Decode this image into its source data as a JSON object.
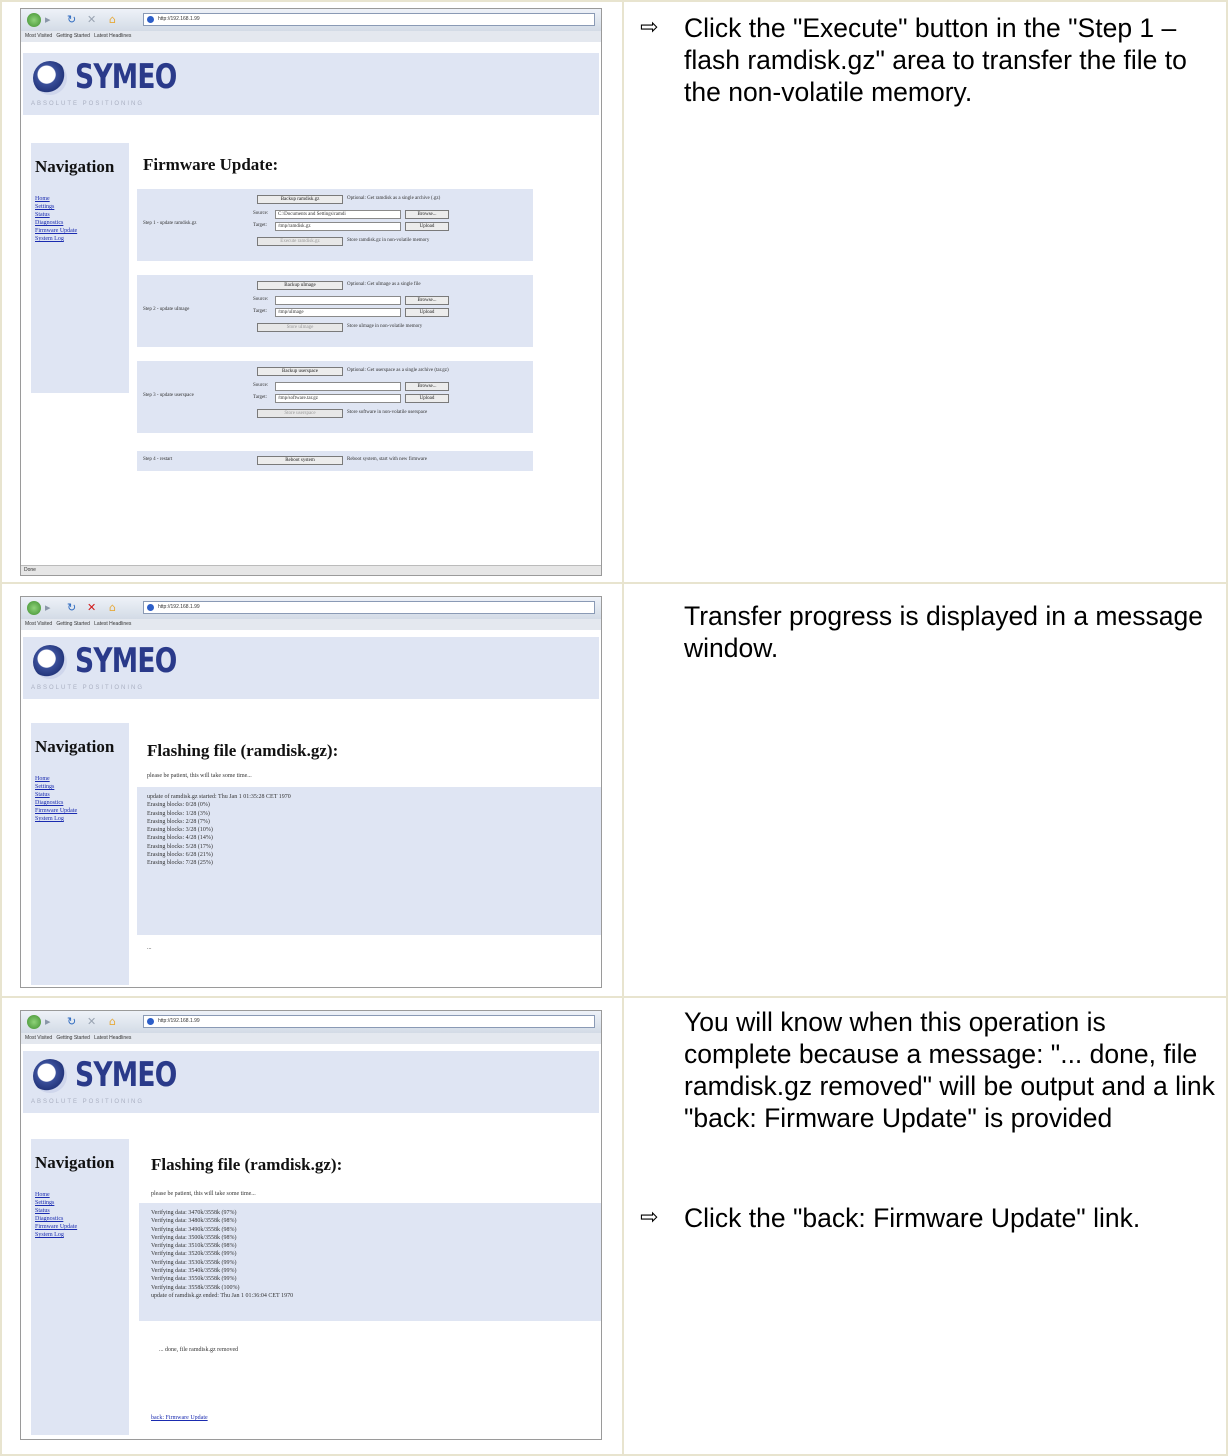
{
  "browser": {
    "url": "http://192.168.1.99",
    "bookmarks": [
      "Most Visited",
      "Getting Started",
      "Latest Headlines"
    ],
    "status": "Done"
  },
  "site": {
    "logo_text": "SYMEO",
    "logo_subtitle": "ABSOLUTE POSITIONING",
    "nav_heading": "Navigation",
    "nav_links": [
      "Home",
      "Settings",
      "Status",
      "Diagnostics",
      "Firmware Update",
      "System Log"
    ]
  },
  "panel1": {
    "title": "Firmware Update:",
    "steps": [
      {
        "label": "Step 1 - update ramdisk.gz",
        "backup": "Backup ramdisk.gz",
        "backup_note": "Optional: Get ramdisk as a single archive (.gz)",
        "source_label": "Source:",
        "source_value": "C:\\Documents and Settings\\ramdi",
        "browse": "Browse...",
        "target_label": "Target:",
        "target_value": "/tmp/ramdisk.gz",
        "upload": "Upload",
        "execute": "Execute ramdisk.gz",
        "execute_note": "Store ramdisk.gz in non-volatile memory"
      },
      {
        "label": "Step 2 - update uImage",
        "backup": "Backup uImage",
        "backup_note": "Optional: Get uImage as a single file",
        "source_label": "Source:",
        "source_value": "",
        "browse": "Browse...",
        "target_label": "Target:",
        "target_value": "/tmp/uImage",
        "upload": "Upload",
        "execute": "Store uImage",
        "execute_note": "Store uImage in non-volatile memory"
      },
      {
        "label": "Step 3 - update userspace",
        "backup": "Backup userspace",
        "backup_note": "Optional: Get userspace as a single archive (tar.gz)",
        "source_label": "Source:",
        "source_value": "",
        "browse": "Browse...",
        "target_label": "Target:",
        "target_value": "/tmp/software.tar.gz",
        "upload": "Upload",
        "execute": "Store userspace",
        "execute_note": "Store software in non-volatile userspace"
      }
    ],
    "step4": {
      "label": "Step 4 - restart",
      "button": "Reboot system",
      "note": "Reboot system, start with new firmware"
    }
  },
  "panel2": {
    "title": "Flashing file (ramdisk.gz):",
    "notice": "please be patient, this will take some time...",
    "log": [
      "update of ramdisk.gz started: Thu Jan 1 01:35:28 CET 1970",
      "Erasing blocks: 0/28 (0%)",
      "Erasing blocks: 1/28 (3%)",
      "Erasing blocks: 2/28 (7%)",
      "Erasing blocks: 3/28 (10%)",
      "Erasing blocks: 4/28 (14%)",
      "Erasing blocks: 5/28 (17%)",
      "Erasing blocks: 6/28 (21%)",
      "Erasing blocks: 7/28 (25%)"
    ],
    "footer": "..."
  },
  "panel3": {
    "title": "Flashing file (ramdisk.gz):",
    "notice": "please be patient, this will take some time...",
    "log": [
      "Verifying data: 3470k/3558k (97%)",
      "Verifying data: 3480k/3558k (98%)",
      "Verifying data: 3490k/3558k (98%)",
      "Verifying data: 3500k/3558k (98%)",
      "Verifying data: 3510k/3558k (98%)",
      "Verifying data: 3520k/3558k (99%)",
      "Verifying data: 3530k/3558k (99%)",
      "Verifying data: 3540k/3558k (99%)",
      "Verifying data: 3550k/3558k (99%)",
      "Verifying data: 3558k/3558k (100%)",
      "update of ramdisk.gz ended: Thu Jan 1 01:36:04 CET 1970"
    ],
    "done": "... done, file ramdisk.gz removed",
    "back_link": "back: Firmware Update"
  },
  "instructions": {
    "row1": "Click the \"Execute\" button in the \"Step 1 – flash ramdisk.gz\" area to transfer the file to the non-volatile memory.",
    "row2": "Transfer progress is displayed in a message window.",
    "row3a": "You will know when this operation is complete because a message: \"...  done, file ramdisk.gz removed\" will be output and a link \"back: Firmware Update\" is provided",
    "row3b": "Click the \"back: Firmware Update\" link.",
    "arrow": "⇨"
  }
}
